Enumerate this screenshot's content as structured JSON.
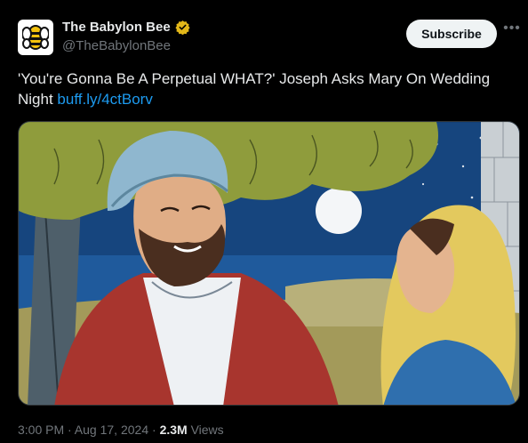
{
  "account": {
    "display_name": "The Babylon Bee",
    "handle": "@TheBabylonBee",
    "verified_color": "#e2b719",
    "avatar_icon": "bee-logo-icon"
  },
  "actions": {
    "subscribe_label": "Subscribe",
    "more_icon": "more-options-icon"
  },
  "tweet": {
    "text": "'You're Gonna Be A Perpetual WHAT?' Joseph Asks Mary On Wedding Night",
    "link_text": "buff.ly/4ctBorv",
    "link_color": "#1d9bf0"
  },
  "media": {
    "type": "illustration"
  },
  "meta": {
    "timestamp": "3:00 PM · Aug 17, 2024",
    "separator": " · ",
    "views_count": "2.3M",
    "views_label": "Views"
  }
}
